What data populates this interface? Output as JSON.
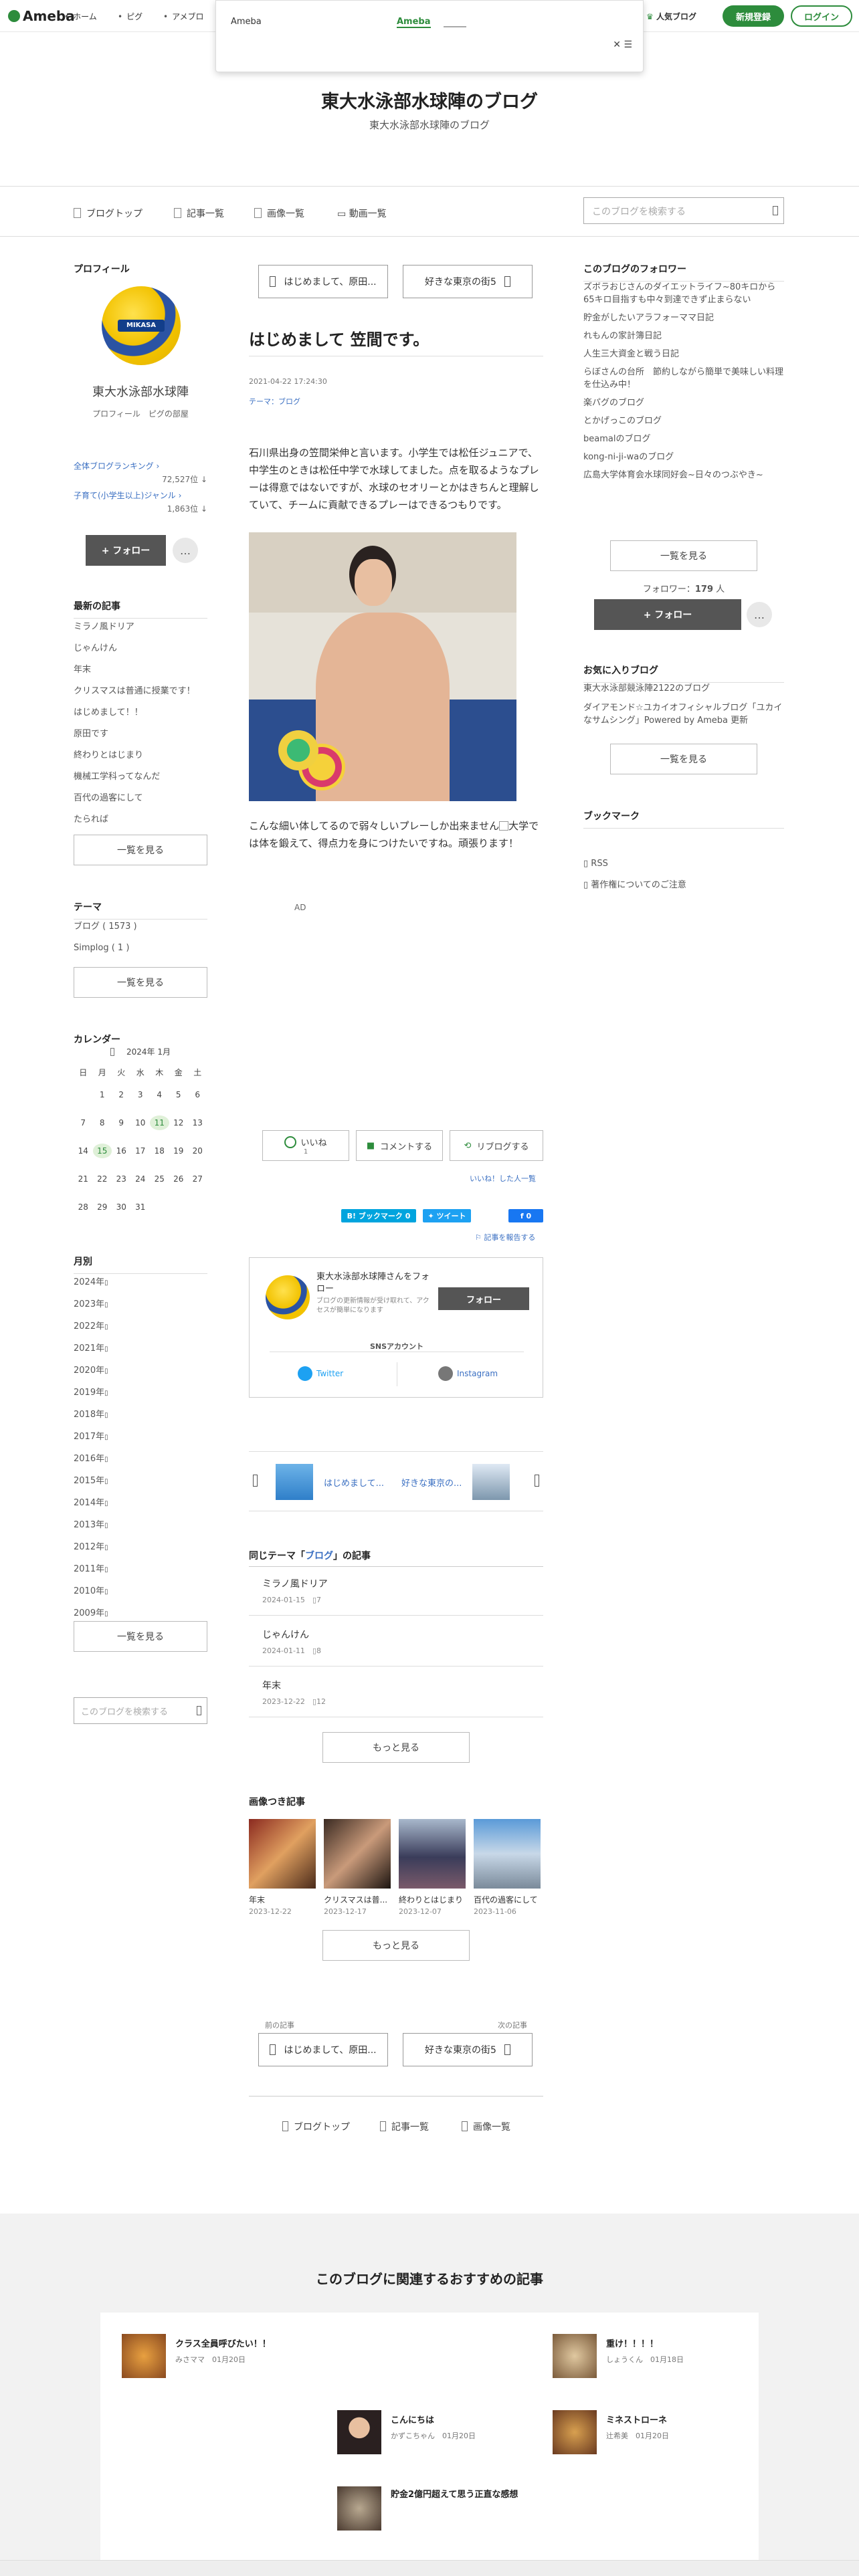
{
  "topbar": {
    "logo": "Ameba",
    "nav": [
      "ホーム",
      "ピグ",
      "アメブロ"
    ],
    "popular": "人気ブログ",
    "signup": "新規登録",
    "login": "ログイン"
  },
  "popup": {
    "label": "Ameba",
    "link": "Ameba"
  },
  "header": {
    "title": "東大水泳部水球陣のブログ",
    "subtitle": "東大水泳部水球陣のブログ"
  },
  "blognav": {
    "items": [
      "ブログトップ",
      "記事一覧",
      "画像一覧",
      "動画一覧"
    ],
    "search_placeholder": "このブログを検索する"
  },
  "profile": {
    "heading": "プロフィール",
    "name": "東大水泳部水球陣",
    "links": [
      "プロフィール",
      "ピグの部屋"
    ],
    "ranking1_label": "全体ブログランキング",
    "ranking1_value": "72,527位",
    "ranking2_label": "子育て(小学生以上)ジャンル",
    "ranking2_value": "1,863位",
    "follow": "+ フォロー",
    "more": "…"
  },
  "recent": {
    "heading": "最新の記事",
    "items": [
      "ミラノ風ドリア",
      "じゃんけん",
      "年末",
      "クリスマスは普通に授業です！",
      "はじめまして！！",
      "原田です",
      "終わりとはじまり",
      "機械工学科ってなんだ",
      "百代の過客にして",
      "たられば"
    ],
    "more": "一覧を見る"
  },
  "themes": {
    "heading": "テーマ",
    "items": [
      "ブログ ( 1573 )",
      "Simplog ( 1 )"
    ],
    "more": "一覧を見る"
  },
  "calendar": {
    "heading": "カレンダー",
    "month": "2024年 1月",
    "weekdays": [
      "日",
      "月",
      "火",
      "水",
      "木",
      "金",
      "土"
    ],
    "weeks": [
      [
        "",
        "1",
        "2",
        "3",
        "4",
        "5",
        "6"
      ],
      [
        "7",
        "8",
        "9",
        "10",
        "11",
        "12",
        "13"
      ],
      [
        "14",
        "15",
        "16",
        "17",
        "18",
        "19",
        "20"
      ],
      [
        "21",
        "22",
        "23",
        "24",
        "25",
        "26",
        "27"
      ],
      [
        "28",
        "29",
        "30",
        "31",
        "",
        "",
        ""
      ]
    ],
    "highlight": [
      "11",
      "15"
    ]
  },
  "monthly": {
    "heading": "月別",
    "items": [
      "2024年",
      "2023年",
      "2022年",
      "2021年",
      "2020年",
      "2019年",
      "2018年",
      "2017年",
      "2016年",
      "2015年",
      "2014年",
      "2013年",
      "2012年",
      "2011年",
      "2010年",
      "2009年"
    ],
    "more": "一覧を見る",
    "search_placeholder": "このブログを検索する"
  },
  "article": {
    "prev_top": "はじめまして、原田...",
    "next_top": "好きな東京の街5",
    "title": "はじめまして 笠間です。",
    "date": "2021-04-22 17:24:30",
    "theme": "テーマ：ブログ",
    "body1": "石川県出身の笠間栄伸と言います。小学生では松任ジュニアで、中学生のときは松任中学で水球してました。点を取るようなプレーは得意ではないですが、水球のセオリーとかはきちんと理解していて、チームに貢献できるプレーはできるつもりです。",
    "body2": "こんな細い体してるので弱々しいプレーしか出来ません",
    "body2_alt": "大",
    "body3": "学では体を鍛えて、得点力を身につけたいですね。頑張ります！",
    "ad": "AD",
    "like": "いいね",
    "like_count": "1",
    "comment": "コメントする",
    "reblog": "リブログする",
    "like_list": "いいね！した人一覧",
    "hatena": "B! ブックマーク",
    "hatena_count": "0",
    "tweet": "ツイート",
    "fb_share": "シェア",
    "fb_count": "0",
    "report": "記事を報告する"
  },
  "follow_card": {
    "title": "東大水泳部水球陣さんをフォロー",
    "desc": "ブログの更新情報が受け取れて、アクセスが簡単になります",
    "button": "フォロー",
    "sns_label": "SNSアカウント",
    "twitter": "Twitter",
    "instagram": "Instagram"
  },
  "mini_nav": {
    "prev": "はじめまして...",
    "next": "好きな東京の..."
  },
  "same_theme": {
    "heading_prefix": "同じテーマ「",
    "heading_theme": "ブログ",
    "heading_suffix": "」の記事",
    "items": [
      {
        "title": "ミラノ風ドリア",
        "date": "2024-01-15",
        "count": "7"
      },
      {
        "title": "じゃんけん",
        "date": "2024-01-11",
        "count": "8"
      },
      {
        "title": "年末",
        "date": "2023-12-22",
        "count": "12"
      }
    ],
    "more": "もっと見る"
  },
  "image_posts": {
    "heading": "画像つき記事",
    "items": [
      {
        "title": "年末",
        "date": "2023-12-22"
      },
      {
        "title": "クリスマスは普...",
        "date": "2023-12-17"
      },
      {
        "title": "終わりとはじまり",
        "date": "2023-12-07"
      },
      {
        "title": "百代の過客にして",
        "date": "2023-11-06"
      }
    ],
    "more": "もっと見る"
  },
  "bottom_nav": {
    "prev_label": "前の記事",
    "next_label": "次の記事",
    "prev": "はじめまして、原田...",
    "next": "好きな東京の街5",
    "links": [
      "ブログトップ",
      "記事一覧",
      "画像一覧"
    ]
  },
  "right": {
    "followers_heading": "このブログのフォロワー",
    "followers": [
      "ズボラおじさんのダイエットライフ~80キロから65キロ目指すも中々到達できず止まらない",
      "貯金がしたいアラフォーママ日記",
      "れもんの家計簿日記",
      "人生三大資金と戦う日記",
      "らぼさんの台所　節約しながら簡単で美味しい料理を仕込み中！",
      "楽パグのブログ",
      "とかげっこのブログ",
      "beamalのブログ",
      "kong-ni-ji-waのブログ",
      "広島大学体育会水球同好会~日々のつぶやき~"
    ],
    "more": "一覧を見る",
    "follower_label": "フォロワー：",
    "follower_count": "179",
    "follower_unit": "人",
    "follow": "+ フォロー",
    "fav_heading": "お気に入りブログ",
    "favs": [
      "東大水泳部競泳陣2122のブログ",
      "ダイアモンド☆ユカイオフィシャルブログ「ユカイなサムシング」Powered by Ameba 更新"
    ],
    "fav_more": "一覧を見る",
    "bookmark_heading": "ブックマーク",
    "rss": "RSS",
    "copyright": "著作権についてのご注意"
  },
  "recommend": {
    "title": "このブログに関連するおすすめの記事",
    "items": [
      {
        "title": "クラス全員呼びたい！！",
        "author": "みさママ",
        "date": "01月20日"
      },
      {
        "title": "重け！！！！",
        "author": "しょうくん",
        "date": "01月18日"
      },
      {
        "title": "こんにちは",
        "author": "かずこちゃん",
        "date": "01月20日"
      },
      {
        "title": "ミネストローネ",
        "author": "辻希美",
        "date": "01月20日"
      },
      {
        "title": "貯金2億円超えて思う正直な感想",
        "author": "",
        "date": ""
      }
    ]
  }
}
